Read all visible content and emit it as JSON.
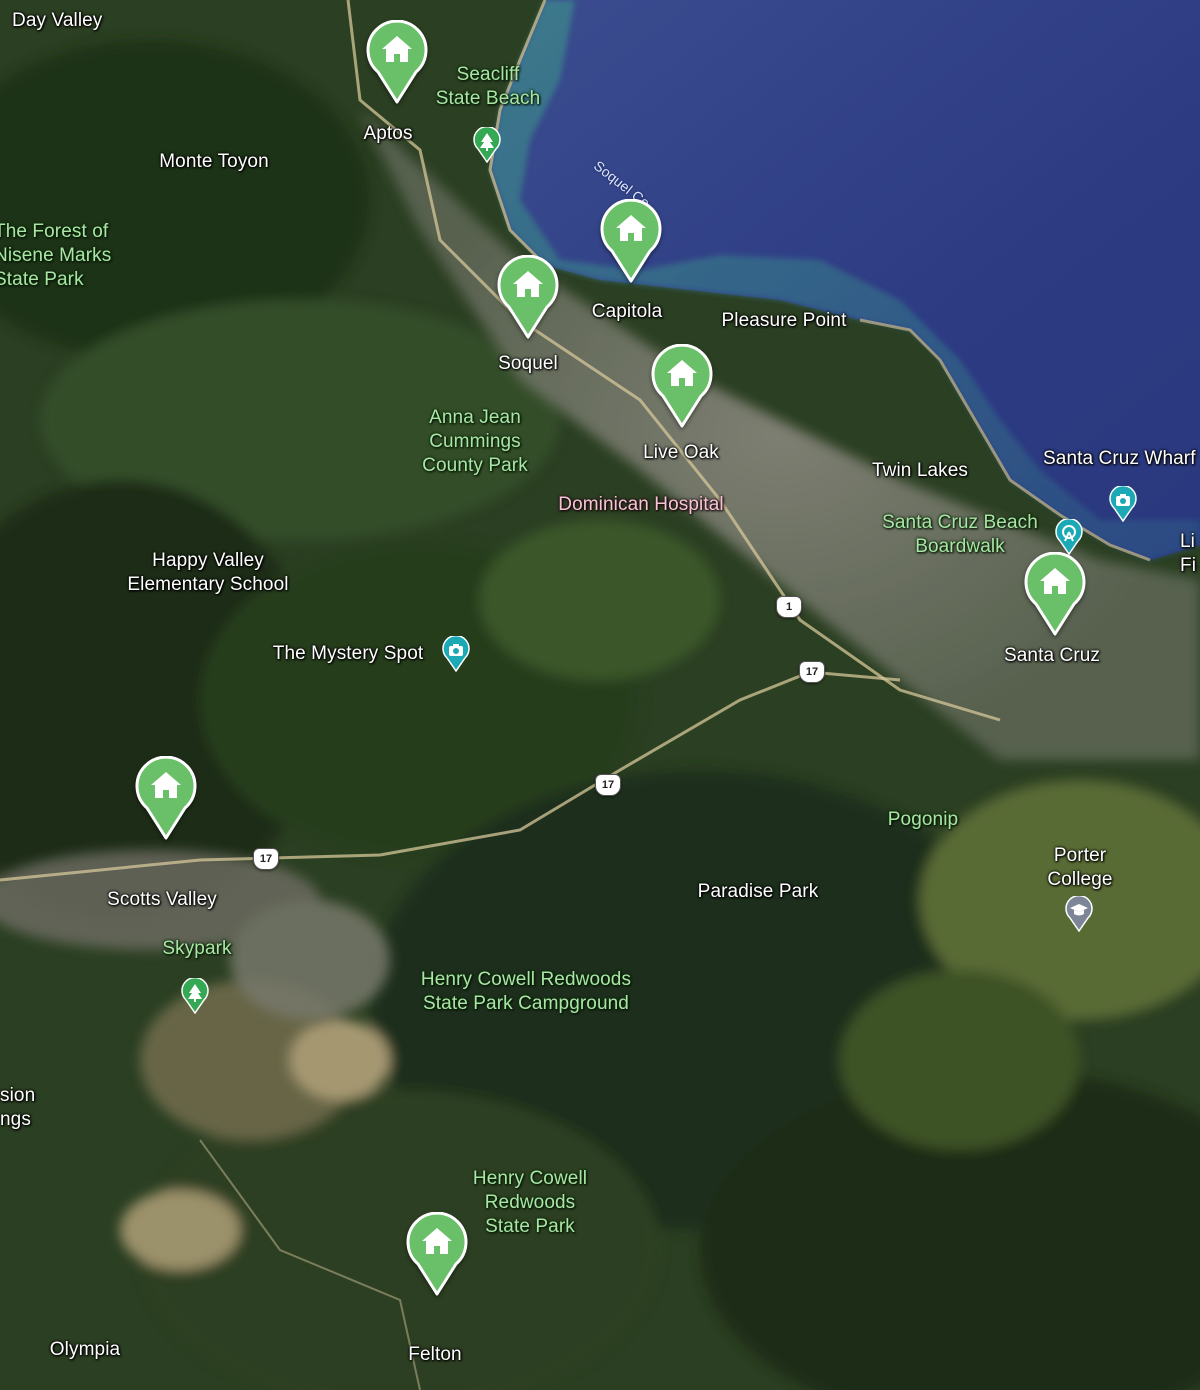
{
  "map": {
    "places": [
      {
        "id": "day-valley",
        "text": "Day Valley",
        "cls": "place left"
      },
      {
        "id": "aptos",
        "text": "Aptos",
        "cls": "place"
      },
      {
        "id": "monte-toyon",
        "text": "Monte Toyon",
        "cls": "place"
      },
      {
        "id": "soquel",
        "text": "Soquel",
        "cls": "place"
      },
      {
        "id": "capitola",
        "text": "Capitola",
        "cls": "place"
      },
      {
        "id": "pleasure-point",
        "text": "Pleasure Point",
        "cls": "place"
      },
      {
        "id": "live-oak",
        "text": "Live Oak",
        "cls": "place"
      },
      {
        "id": "twin-lakes",
        "text": "Twin Lakes",
        "cls": "place"
      },
      {
        "id": "santa-cruz-wharf",
        "text": "Santa Cruz Wharf",
        "cls": "place left"
      },
      {
        "id": "santa-cruz",
        "text": "Santa Cruz",
        "cls": "place"
      },
      {
        "id": "happy-valley-school",
        "text": "Happy Valley\nElementary School",
        "cls": "place"
      },
      {
        "id": "mystery-spot",
        "text": "The Mystery Spot",
        "cls": "place"
      },
      {
        "id": "paradise-park",
        "text": "Paradise Park",
        "cls": "place"
      },
      {
        "id": "porter-college",
        "text": "Porter College",
        "cls": "place"
      },
      {
        "id": "scotts-valley",
        "text": "Scotts Valley",
        "cls": "place"
      },
      {
        "id": "olympia",
        "text": "Olympia",
        "cls": "place"
      },
      {
        "id": "felton",
        "text": "Felton",
        "cls": "place"
      },
      {
        "id": "edge-sion",
        "text": "sion\nngs",
        "cls": "place left"
      },
      {
        "id": "edge-li",
        "text": "Li\nFi",
        "cls": "place left"
      },
      {
        "id": "dominican-hospital",
        "text": "Dominican Hospital",
        "cls": "hospital"
      },
      {
        "id": "seacliff",
        "text": "Seacliff\nState Beach",
        "cls": "park"
      },
      {
        "id": "nisene-marks",
        "text": "The Forest of\nNisene Marks\nState Park",
        "cls": "park left"
      },
      {
        "id": "anna-jean",
        "text": "Anna Jean\nCummings\nCounty Park",
        "cls": "park"
      },
      {
        "id": "sc-beach-boardwalk",
        "text": "Santa Cruz Beach\nBoardwalk",
        "cls": "park"
      },
      {
        "id": "pogonip",
        "text": "Pogonip",
        "cls": "park"
      },
      {
        "id": "skypark",
        "text": "Skypark",
        "cls": "park"
      },
      {
        "id": "henry-cowell-campground",
        "text": "Henry Cowell Redwoods\nState Park Campground",
        "cls": "park"
      },
      {
        "id": "henry-cowell-sp",
        "text": "Henry Cowell\nRedwoods\nState Park",
        "cls": "park"
      },
      {
        "id": "soquel-cove",
        "text": "Soquel Co",
        "cls": "water"
      }
    ],
    "pins": [
      "aptos",
      "capitola",
      "soquel",
      "live-oak",
      "santa-cruz",
      "scotts-valley",
      "felton"
    ],
    "pois": [
      {
        "id": "seacliff-park",
        "icon": "tree-icon"
      },
      {
        "id": "skypark-park",
        "icon": "tree-icon"
      },
      {
        "id": "mystery-spot-poi",
        "icon": "camera-icon"
      },
      {
        "id": "wharf-poi",
        "icon": "camera-icon"
      },
      {
        "id": "boardwalk-poi",
        "icon": "ferris-wheel-icon"
      },
      {
        "id": "porter-poi",
        "icon": "graduation-cap-icon"
      }
    ],
    "highway_shields": [
      {
        "id": "hwy-1-a",
        "text": "1"
      },
      {
        "id": "hwy-17-a",
        "text": "17"
      },
      {
        "id": "hwy-17-b",
        "text": "17"
      },
      {
        "id": "hwy-17-c",
        "text": "17"
      }
    ],
    "colors": {
      "home_pin": "#6abf69",
      "park_label": "#a9e6a6",
      "ocean": "#2f3f86",
      "poi_teal": "#1aa9b5",
      "poi_green": "#34a853",
      "poi_gray": "#7d8696"
    }
  }
}
